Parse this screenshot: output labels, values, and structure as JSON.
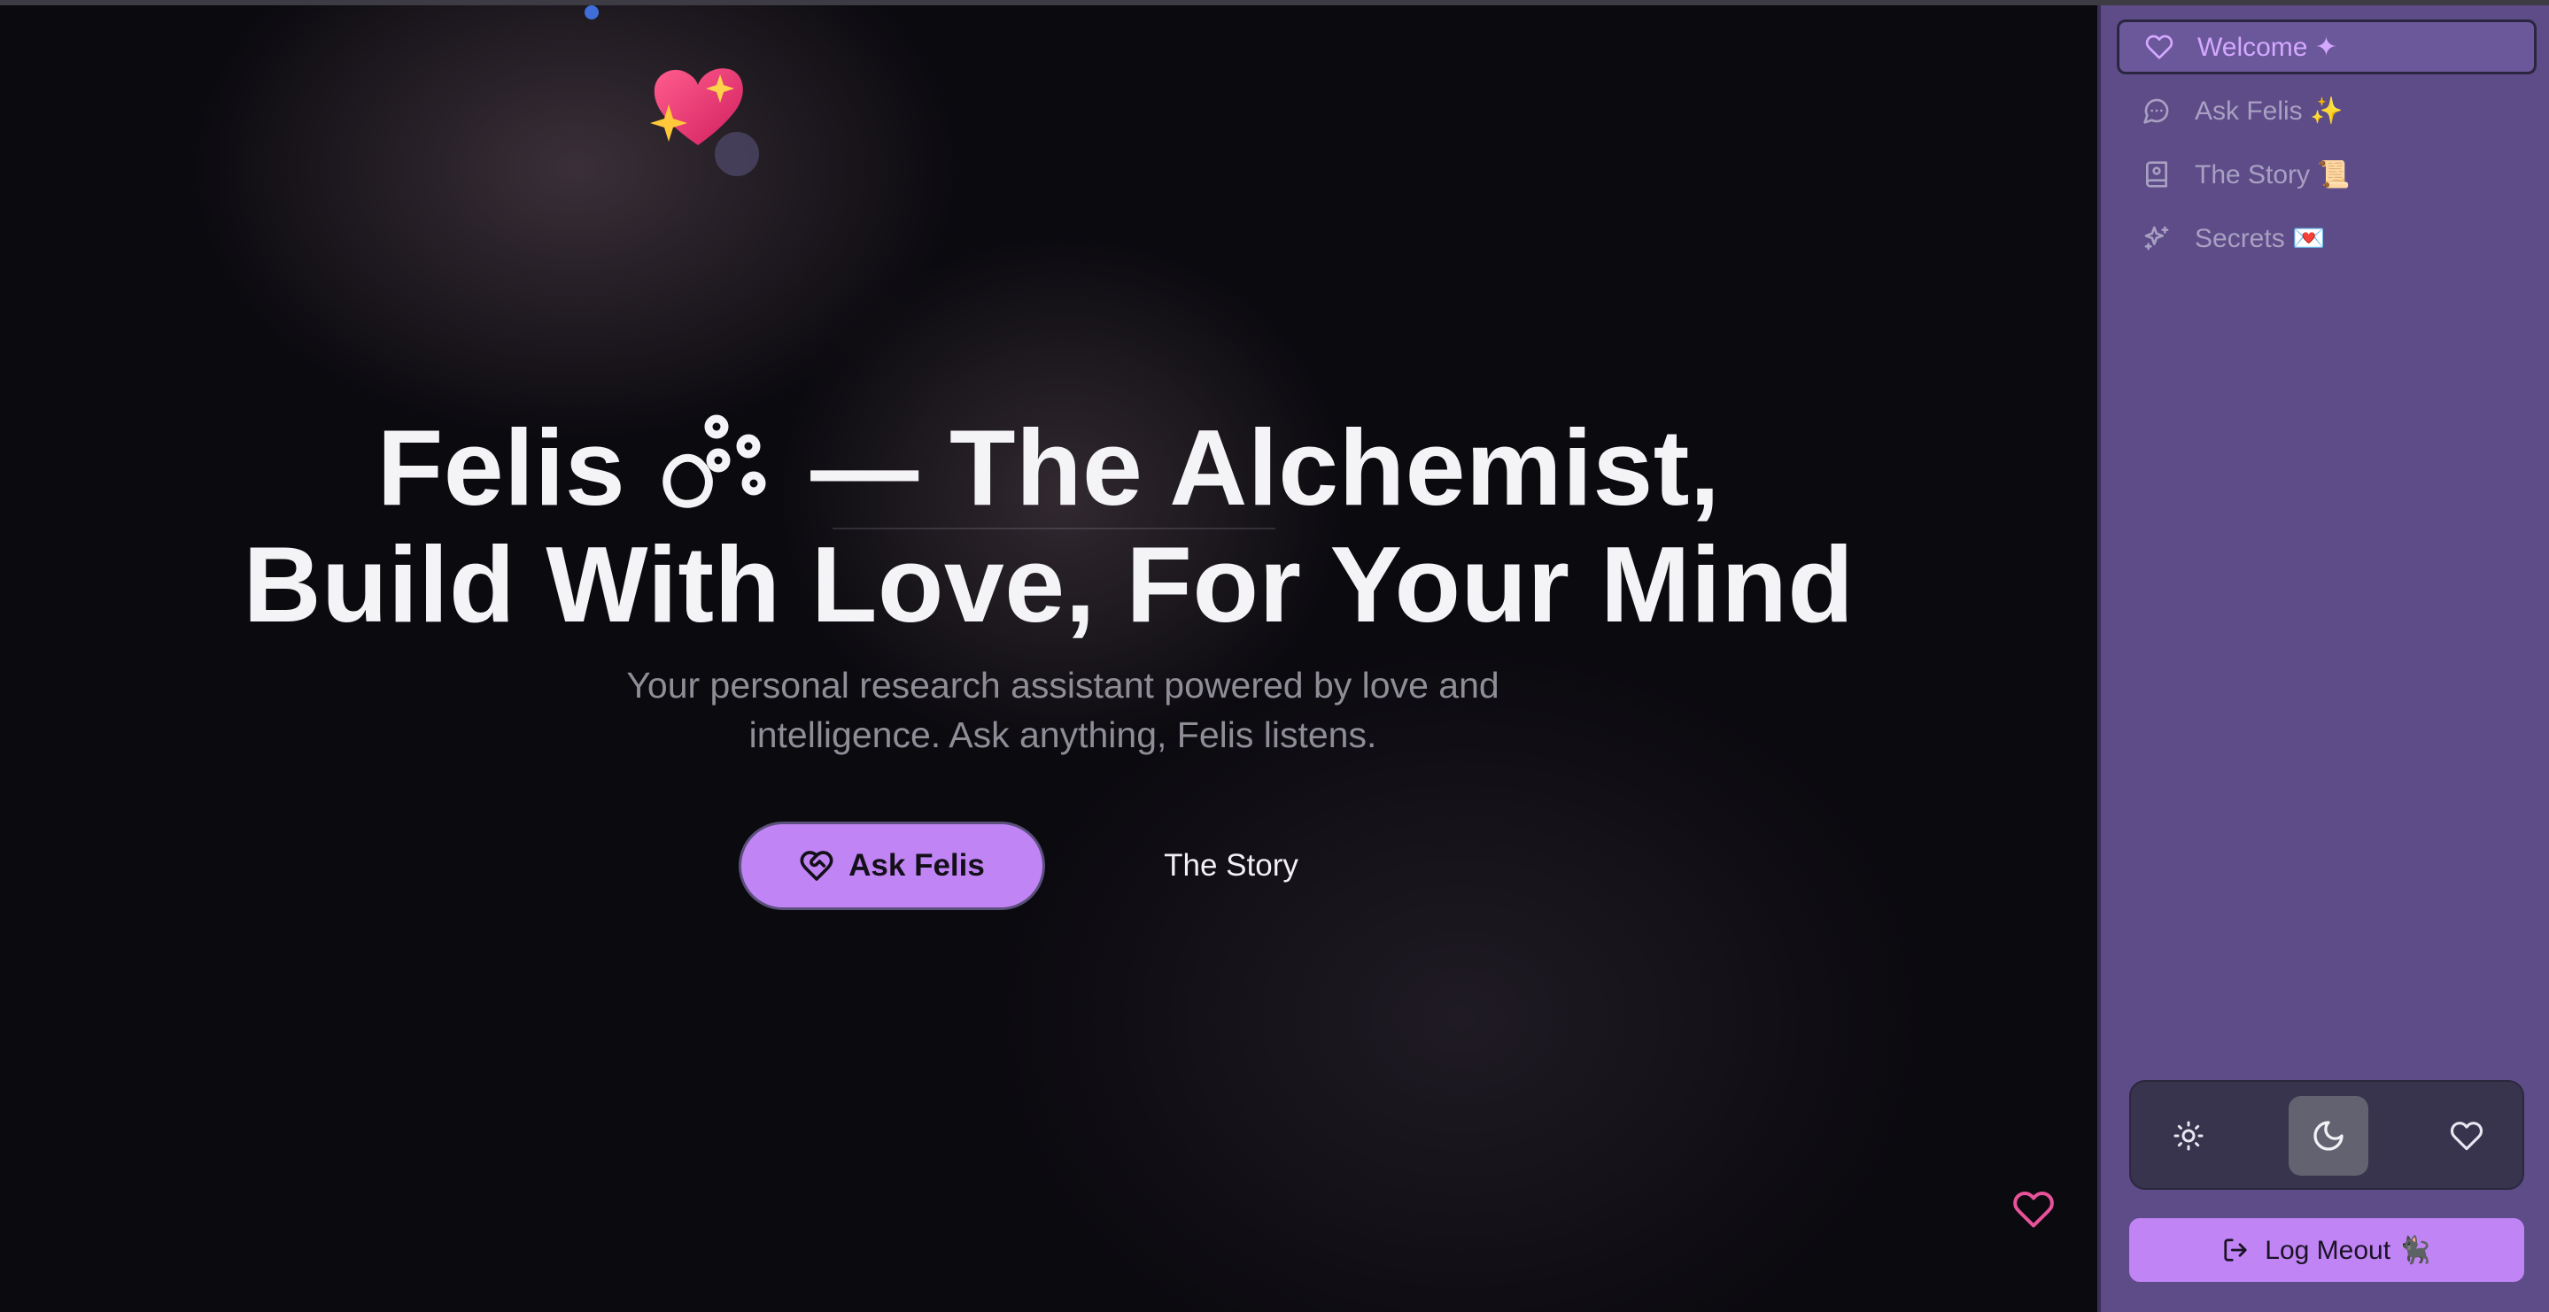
{
  "hero": {
    "title_line1_pre": "Felis",
    "title_line1_post": "— The Alchemist,",
    "title_line2": "Build With Love, For Your Mind",
    "subtitle_line1": "Your personal research assistant powered by love and",
    "subtitle_line2": "intelligence. Ask anything, Felis listens.",
    "primary_button": "Ask Felis",
    "secondary_button": "The Story"
  },
  "sidebar": {
    "items": [
      {
        "label": "Welcome ✦",
        "icon": "heart-icon",
        "active": true
      },
      {
        "label": "Ask Felis ✨",
        "icon": "message-circle-icon",
        "active": false
      },
      {
        "label": "The Story 📜",
        "icon": "book-icon",
        "active": false
      },
      {
        "label": "Secrets 💌",
        "icon": "sparkles-icon",
        "active": false
      }
    ],
    "theme_options": [
      "sun-icon",
      "moon-icon",
      "heart-icon"
    ],
    "theme_selected": "moon-icon",
    "logout_label": "Log Meout 🐈‍⬛"
  },
  "colors": {
    "background": "#0b0a0f",
    "sidebar": "#5d4c88",
    "accent": "#c184f5",
    "active_nav_text": "#d4a8ff",
    "floating_heart": "#e8529b"
  }
}
